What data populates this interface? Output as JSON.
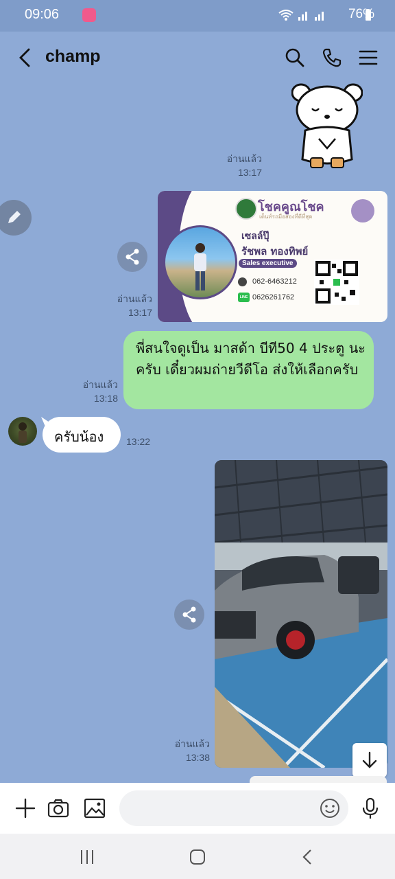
{
  "status_bar": {
    "time": "09:06",
    "battery": "76%"
  },
  "header": {
    "title": "champ"
  },
  "messages": {
    "sticker_read": "อ่านแล้ว",
    "sticker_time": "13:17",
    "card_read": "อ่านแล้ว",
    "card_time": "13:17",
    "text_read": "อ่านแล้ว",
    "text_time": "13:18",
    "text_body": "พี่สนใจดูเป็น  มาสด้า บีที50 4 ประตู นะครับ เดี๋ยวผมถ่ายวีดีโอ ส่งให้เลือกครับ",
    "reply_text": "ครับน้อง",
    "reply_time": "13:22",
    "photo_read": "อ่านแล้ว",
    "photo_time": "13:38"
  },
  "business_card": {
    "brand": "โชคคูณโชค",
    "tagline": "เต็นท์รถมือสองที่ดีที่สุด",
    "nickname": "เซลล์ปุ๊",
    "name": "รัชพล  ทองทิพย์",
    "role": "Sales executive",
    "phone": "062-6463212",
    "line_badge": "LINE",
    "line_id": "0626261762"
  },
  "icons": {
    "back": "chevron-left-icon",
    "search": "search-icon",
    "call": "phone-icon",
    "menu": "menu-icon",
    "share": "share-icon",
    "edit": "pencil-icon",
    "add": "plus-icon",
    "camera": "camera-icon",
    "gallery": "image-icon",
    "emoji": "emoji-icon",
    "mic": "microphone-icon",
    "scroll_down": "arrow-down-icon"
  },
  "colors": {
    "chat_background": "#8eaad6",
    "my_bubble": "#a3e6a0",
    "their_bubble": "#ffffff",
    "card_accent": "#5c4a86"
  }
}
